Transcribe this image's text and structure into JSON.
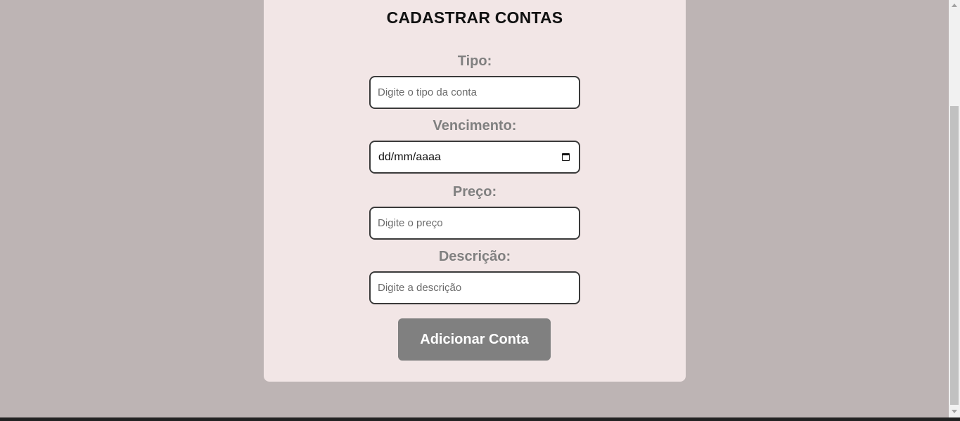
{
  "form": {
    "title": "CADASTRAR CONTAS",
    "fields": [
      {
        "label": "Tipo:",
        "placeholder": "Digite o tipo da conta"
      },
      {
        "label": "Vencimento:",
        "value": "dd/mm/aaaa"
      },
      {
        "label": "Preço:",
        "placeholder": "Digite o preço"
      },
      {
        "label": "Descrição:",
        "placeholder": "Digite a descrição"
      }
    ],
    "submit_label": "Adicionar Conta"
  },
  "icons": {
    "date": "calendar-icon"
  },
  "colors": {
    "page_background": "#bdb4b4",
    "card_background": "#f2e6e6",
    "label_color": "#808080",
    "button_background": "#808080",
    "button_text": "#ffffff"
  }
}
